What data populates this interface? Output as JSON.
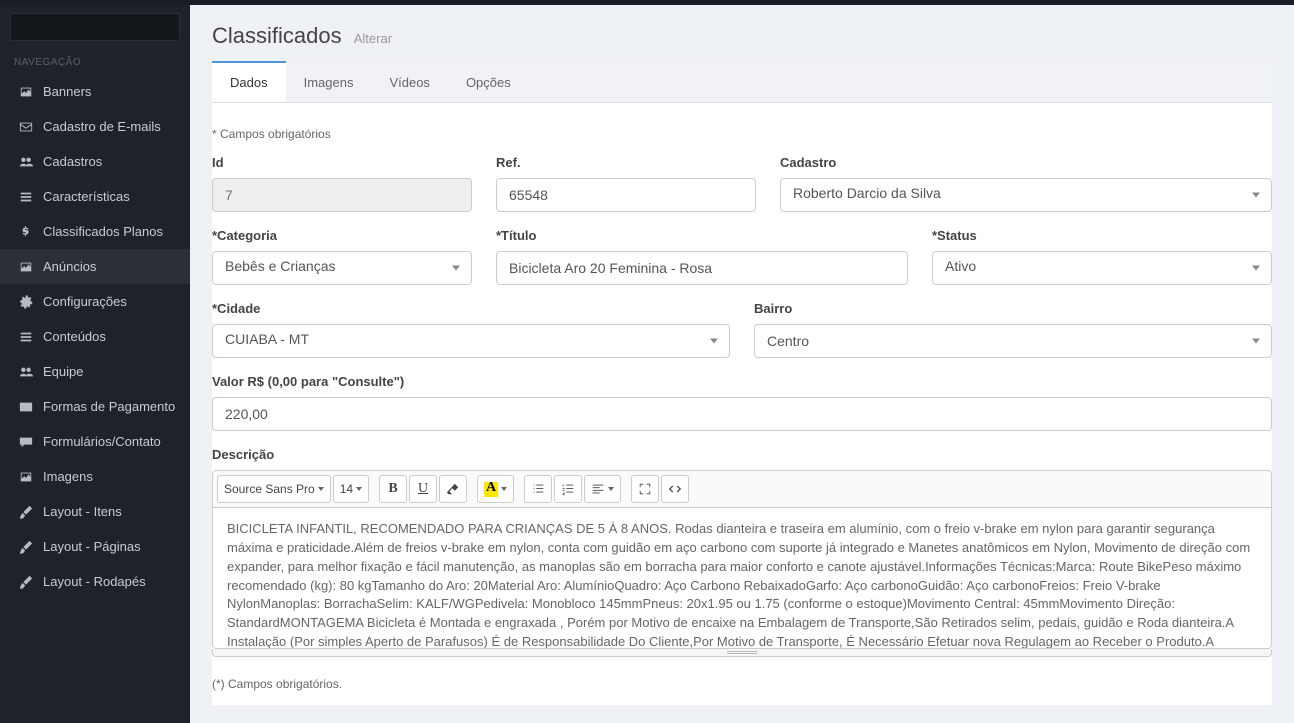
{
  "nav_header": "NAVEGAÇÃO",
  "sidebar": {
    "items": [
      {
        "label": "Banners",
        "icon": "images"
      },
      {
        "label": "Cadastro de E-mails",
        "icon": "envelope"
      },
      {
        "label": "Cadastros",
        "icon": "users"
      },
      {
        "label": "Características",
        "icon": "list"
      },
      {
        "label": "Classificados Planos",
        "icon": "dollar"
      },
      {
        "label": "Anúncios",
        "icon": "images",
        "active": true
      },
      {
        "label": "Configurações",
        "icon": "cogs"
      },
      {
        "label": "Conteúdos",
        "icon": "list"
      },
      {
        "label": "Equipe",
        "icon": "users"
      },
      {
        "label": "Formas de Pagamento",
        "icon": "credit"
      },
      {
        "label": "Formulários/Contato",
        "icon": "comment"
      },
      {
        "label": "Imagens",
        "icon": "images"
      },
      {
        "label": "Layout - Itens",
        "icon": "brush"
      },
      {
        "label": "Layout - Páginas",
        "icon": "brush"
      },
      {
        "label": "Layout - Rodapés",
        "icon": "brush"
      }
    ]
  },
  "page": {
    "title": "Classificados",
    "subtitle": "Alterar"
  },
  "tabs": [
    {
      "label": "Dados",
      "active": true
    },
    {
      "label": "Imagens"
    },
    {
      "label": "Vídeos"
    },
    {
      "label": "Opções"
    }
  ],
  "mandatory_note": "* Campos obrigatórios",
  "form": {
    "id": {
      "label": "Id",
      "value": "7"
    },
    "ref": {
      "label": "Ref.",
      "value": "65548"
    },
    "cadastro": {
      "label": "Cadastro",
      "value": "Roberto Darcio da Silva"
    },
    "categoria": {
      "label": "*Categoria",
      "value": "Bebês e Crianças"
    },
    "titulo": {
      "label": "*Título",
      "value": "Bicicleta Aro 20 Feminina - Rosa"
    },
    "status": {
      "label": "*Status",
      "value": "Ativo"
    },
    "cidade": {
      "label": "*Cidade",
      "value": "CUIABA - MT"
    },
    "bairro": {
      "label": "Bairro",
      "value": "Centro"
    },
    "valor": {
      "label": "Valor R$ (0,00 para \"Consulte\")",
      "value": "220,00"
    },
    "descricao": {
      "label": "Descrição",
      "font": "Source Sans Pro",
      "size": "14",
      "body": "BICICLETA INFANTIL, RECOMENDADO PARA CRIANÇAS DE 5 À 8 ANOS. Rodas dianteira e traseira em alumínio, com o freio v-brake em nylon para garantir segurança máxima e praticidade.Além de freios v-brake em nylon, conta com guidão em aço carbono com suporte já integrado e Manetes anatômicos em Nylon, Movimento de direção com expander, para melhor fixação e fácil manutenção, as manoplas são em borracha para maior conforto e canote ajustável.Informações Técnicas:Marca: Route BikePeso máximo recomendado (kg): 80 kgTamanho do Aro: 20Material Aro: AlumínioQuadro: Aço Carbono RebaixadoGarfo: Aço carbonoGuidão: Aço carbonoFreios: Freio V-brake NylonManoplas: BorrachaSelim: KALF/WGPedivela: Monobloco 145mmPneus: 20x1.95 ou 1.75 (conforme o estoque)Movimento Central: 45mmMovimento Direção: StandardMONTAGEMA Bicicleta é Montada e engraxada , Porém por Motivo de encaixe na Embalagem de Transporte,São Retirados selim, pedais, guidão e Roda dianteira.A Instalação (Por simples Aperto de Parafusos) É de Responsabilidade Do Cliente,Por Motivo de Transporte, É Necessário Efetuar nova Regulagem ao Receber o Produto.A Empresa não se Responsabiliza pela Revisão Final da Bicicleta, Se não tiver conhecimento basico de mecânica,é Sugerido que a Montagem Seja Efetuada por Oficina Especializada.A garantia não Cobre Defeitos por Mau uso ou Pela Montagem Inadequada do Produto.Por Motivo de"
    }
  },
  "footer_note": "(*) Campos obrigatórios."
}
